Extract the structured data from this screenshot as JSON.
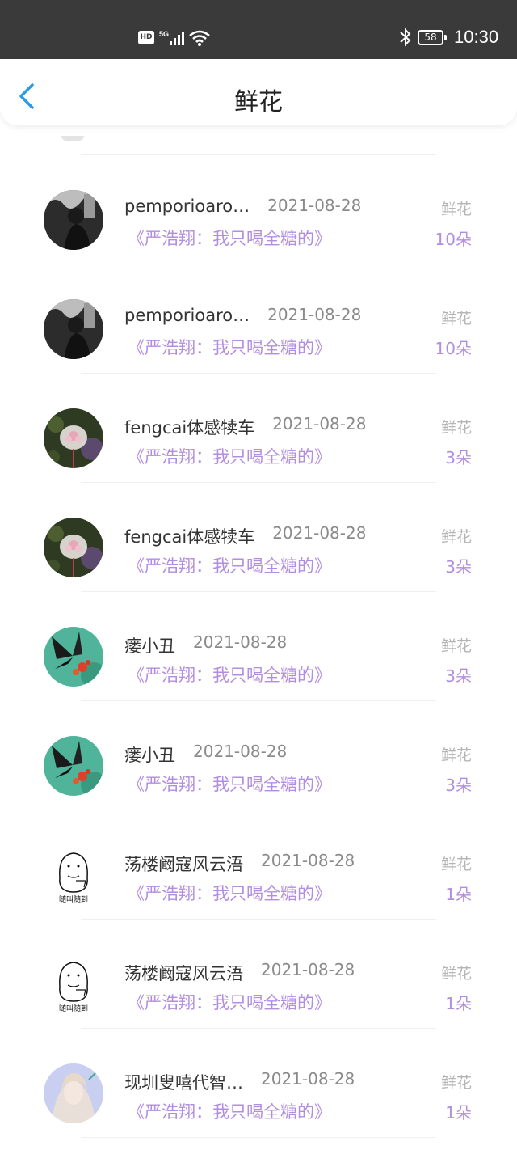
{
  "status_bar": {
    "hd_label": "HD",
    "network_label": "5G",
    "battery": "58",
    "time": "10:30"
  },
  "header": {
    "title": "鲜花"
  },
  "colors": {
    "accent_purple": "#b28ee0",
    "back_blue": "#2a9be8",
    "status_bar_bg": "#3a3a3a"
  },
  "rows": [
    {
      "name": "pemporioaro…",
      "date": "2021-08-28",
      "gift": "鲜花",
      "work": "《严浩翔：我只喝全糖的》",
      "count": "10朵",
      "avatar": "bw-photo"
    },
    {
      "name": "pemporioaro…",
      "date": "2021-08-28",
      "gift": "鲜花",
      "work": "《严浩翔：我只喝全糖的》",
      "count": "10朵",
      "avatar": "bw-photo"
    },
    {
      "name": "fengcai体感犊车",
      "date": "2021-08-28",
      "gift": "鲜花",
      "work": "《严浩翔：我只喝全糖的》",
      "count": "3朵",
      "avatar": "flower-bell"
    },
    {
      "name": "fengcai体感犊车",
      "date": "2021-08-28",
      "gift": "鲜花",
      "work": "《严浩翔：我只喝全糖的》",
      "count": "3朵",
      "avatar": "flower-bell"
    },
    {
      "name": "瘘小丑",
      "date": "2021-08-28",
      "gift": "鲜花",
      "work": "《严浩翔：我只喝全糖的》",
      "count": "3朵",
      "avatar": "butterfly"
    },
    {
      "name": "瘘小丑",
      "date": "2021-08-28",
      "gift": "鲜花",
      "work": "《严浩翔：我只喝全糖的》",
      "count": "3朵",
      "avatar": "butterfly"
    },
    {
      "name": "荡楼阚寇风云浯",
      "date": "2021-08-28",
      "gift": "鲜花",
      "work": "《严浩翔：我只喝全糖的》",
      "count": "1朵",
      "avatar": "sketch",
      "avatar_caption": "随叫随到"
    },
    {
      "name": "荡楼阚寇风云浯",
      "date": "2021-08-28",
      "gift": "鲜花",
      "work": "《严浩翔：我只喝全糖的》",
      "count": "1朵",
      "avatar": "sketch",
      "avatar_caption": "随叫随到"
    },
    {
      "name": "现圳叟嘻代智…",
      "date": "2021-08-28",
      "gift": "鲜花",
      "work": "《严浩翔：我只喝全糖的》",
      "count": "1朵",
      "avatar": "portrait"
    }
  ]
}
